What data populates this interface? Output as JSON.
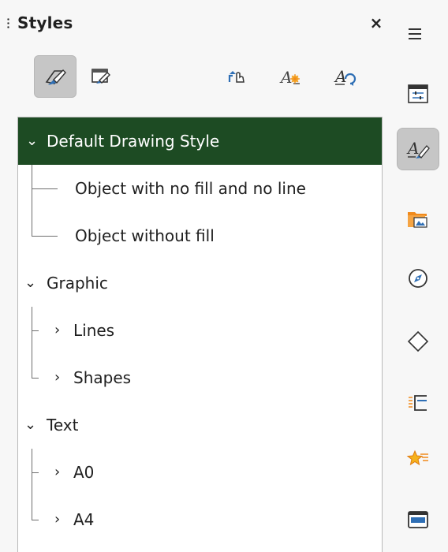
{
  "panel": {
    "title": "Styles",
    "close_symbol": "×"
  },
  "toolbar": [
    {
      "icon": "drawing-styles-icon",
      "active": true
    },
    {
      "icon": "presentation-styles-icon",
      "active": false
    },
    {
      "icon": "fill-format-mode-icon",
      "active": false
    },
    {
      "icon": "new-style-from-selection-icon",
      "active": false
    },
    {
      "icon": "update-style-icon",
      "active": false
    }
  ],
  "tree": {
    "items": [
      {
        "label": "Default Drawing Style",
        "level": 0,
        "expander": "⌄",
        "selected": true
      },
      {
        "label": "Object with no fill and no line",
        "level": 1,
        "expander": ""
      },
      {
        "label": "Object without fill",
        "level": 1,
        "expander": ""
      },
      {
        "label": "Graphic",
        "level": 0,
        "expander": "⌄"
      },
      {
        "label": "Lines",
        "level": 1,
        "expander": "›"
      },
      {
        "label": "Shapes",
        "level": 1,
        "expander": "›"
      },
      {
        "label": "Text",
        "level": 0,
        "expander": "⌄"
      },
      {
        "label": "A0",
        "level": 1,
        "expander": "›"
      },
      {
        "label": "A4",
        "level": 1,
        "expander": "›"
      }
    ]
  },
  "sidebar_deck": {
    "menu_icon": "hamburger-menu-icon",
    "tabs": [
      {
        "icon": "properties-icon",
        "active": false
      },
      {
        "icon": "styles-icon",
        "active": true
      },
      {
        "icon": "gallery-icon",
        "active": false
      },
      {
        "icon": "navigator-icon",
        "active": false
      },
      {
        "icon": "shapes-icon",
        "active": false
      },
      {
        "icon": "slide-transition-icon",
        "active": false
      },
      {
        "icon": "animation-icon",
        "active": false
      },
      {
        "icon": "master-slides-icon",
        "active": false
      }
    ]
  },
  "colors": {
    "selection": "#1d4b23",
    "accent_blue": "#2f6fb5",
    "accent_orange": "#f08a1c"
  }
}
